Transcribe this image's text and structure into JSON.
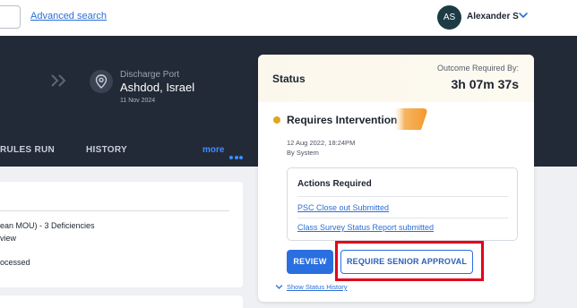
{
  "header": {
    "advanced_search_label": "Advanced search",
    "user": {
      "initials": "AS",
      "name": "Alexander S"
    }
  },
  "voyage": {
    "discharge_port_label": "Discharge Port",
    "discharge_port_name": "Ashdod, Israel",
    "discharge_port_date": "11 Nov 2024"
  },
  "tabs": [
    {
      "label": "RULES RUN"
    },
    {
      "label": "HISTORY"
    },
    {
      "label": "more"
    }
  ],
  "left_card": {
    "lines": [
      "ean MOU) - 3 Deficiencies",
      "view",
      "ocessed"
    ]
  },
  "status": {
    "title": "Status",
    "outcome_label": "Outcome Required By:",
    "countdown": "3h 07m 37s",
    "state": "Requires Intervention",
    "state_color": "#e0a61d",
    "state_date": "12 Aug 2022, 18:24PM",
    "state_by": "By System",
    "actions_title": "Actions Required",
    "actions": [
      "PSC Close out Submitted",
      "Class Survey Status Report submitted"
    ],
    "review_label": "REVIEW",
    "senior_approval_label": "REQUIRE SENIOR APPROVAL",
    "history_link": "Show Status History"
  },
  "colors": {
    "accent": "#2a6fe0",
    "header_dark": "#232a37",
    "highlight": "#e3001b"
  }
}
